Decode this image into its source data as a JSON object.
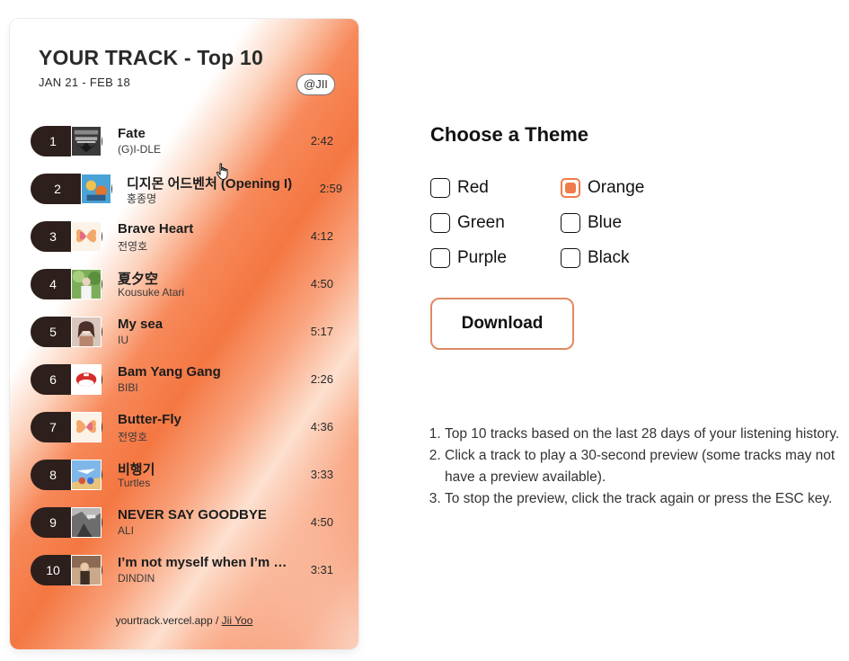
{
  "card": {
    "title": "YOUR TRACK - Top 10",
    "dates": "JAN 21 - FEB 18",
    "handle": "@JII",
    "footer_site": "yourtrack.vercel.app",
    "footer_sep": " / ",
    "footer_author": "Jii Yoo",
    "gradient_color": "#f47742"
  },
  "tracks": [
    {
      "rank": "1",
      "title": "Fate",
      "artist": "(G)I-DLE",
      "duration": "2:42",
      "art": "dark-grid-art"
    },
    {
      "rank": "2",
      "title": "디지몬 어드벤처 (Opening I)",
      "artist": "홍종명",
      "duration": "2:59",
      "art": "digimon-art"
    },
    {
      "rank": "3",
      "title": "Brave Heart",
      "artist": "전영호",
      "duration": "4:12",
      "art": "butterfly-art"
    },
    {
      "rank": "4",
      "title": "夏夕空",
      "artist": "Kousuke Atari",
      "duration": "4:50",
      "art": "green-portrait-art"
    },
    {
      "rank": "5",
      "title": "My sea",
      "artist": "IU",
      "duration": "5:17",
      "art": "portrait-art"
    },
    {
      "rank": "6",
      "title": "Bam Yang Gang",
      "artist": "BIBI",
      "duration": "2:26",
      "art": "red-white-art"
    },
    {
      "rank": "7",
      "title": "Butter-Fly",
      "artist": "전영호",
      "duration": "4:36",
      "art": "butterfly-art"
    },
    {
      "rank": "8",
      "title": "비행기",
      "artist": "Turtles",
      "duration": "3:33",
      "art": "sky-art"
    },
    {
      "rank": "9",
      "title": "NEVER SAY GOODBYE",
      "artist": "ALI",
      "duration": "4:50",
      "art": "gray-art"
    },
    {
      "rank": "10",
      "title": "I’m not myself when I’m …",
      "artist": "DINDIN",
      "duration": "3:31",
      "art": "warm-photo-art"
    }
  ],
  "theme": {
    "heading": "Choose a Theme",
    "options": [
      {
        "label": "Red",
        "checked": false
      },
      {
        "label": "Orange",
        "checked": true
      },
      {
        "label": "Green",
        "checked": false
      },
      {
        "label": "Blue",
        "checked": false
      },
      {
        "label": "Purple",
        "checked": false
      },
      {
        "label": "Black",
        "checked": false
      }
    ],
    "accent": "#f07b4a"
  },
  "download_label": "Download",
  "instructions": [
    "Top 10 tracks based on the last 28 days of your listening history.",
    "Click a track to play a 30-second preview (some tracks may not have a preview available).",
    "To stop the preview, click the track again or press the ESC key."
  ]
}
